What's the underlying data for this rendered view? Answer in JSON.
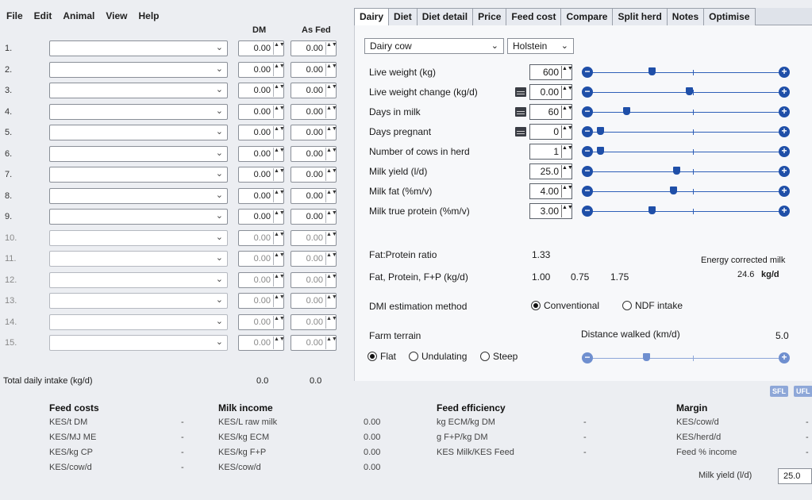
{
  "menu": [
    "File",
    "Edit",
    "Animal",
    "View",
    "Help"
  ],
  "feed_table": {
    "col_dm": "DM",
    "col_asfed": "As Fed",
    "rows": [
      {
        "num": "1.",
        "dm": "0.00",
        "asfed": "0.00"
      },
      {
        "num": "2.",
        "dm": "0.00",
        "asfed": "0.00"
      },
      {
        "num": "3.",
        "dm": "0.00",
        "asfed": "0.00"
      },
      {
        "num": "4.",
        "dm": "0.00",
        "asfed": "0.00"
      },
      {
        "num": "5.",
        "dm": "0.00",
        "asfed": "0.00"
      },
      {
        "num": "6.",
        "dm": "0.00",
        "asfed": "0.00"
      },
      {
        "num": "7.",
        "dm": "0.00",
        "asfed": "0.00"
      },
      {
        "num": "8.",
        "dm": "0.00",
        "asfed": "0.00"
      },
      {
        "num": "9.",
        "dm": "0.00",
        "asfed": "0.00"
      },
      {
        "num": "10.",
        "dm": "0.00",
        "asfed": "0.00"
      },
      {
        "num": "11.",
        "dm": "0.00",
        "asfed": "0.00"
      },
      {
        "num": "12.",
        "dm": "0.00",
        "asfed": "0.00"
      },
      {
        "num": "13.",
        "dm": "0.00",
        "asfed": "0.00"
      },
      {
        "num": "14.",
        "dm": "0.00",
        "asfed": "0.00"
      },
      {
        "num": "15.",
        "dm": "0.00",
        "asfed": "0.00"
      }
    ],
    "total_label": "Total daily intake (kg/d)",
    "total_dm": "0.0",
    "total_asfed": "0.0"
  },
  "tabs": [
    "Dairy",
    "Diet",
    "Diet detail",
    "Price",
    "Feed cost",
    "Compare",
    "Split herd",
    "Notes",
    "Optimise"
  ],
  "active_tab": "Dairy",
  "dairy": {
    "animal_type": "Dairy cow",
    "breed": "Holstein",
    "params": [
      {
        "label": "Live weight (kg)",
        "value": "600",
        "slider_level": 0.31,
        "calc": false
      },
      {
        "label": "Live weight change (kg/d)",
        "value": "0.00",
        "slider_level": 0.52,
        "calc": true
      },
      {
        "label": "Days in milk",
        "value": "60",
        "slider_level": 0.17,
        "calc": true
      },
      {
        "label": "Days pregnant",
        "value": "0",
        "slider_level": 0.02,
        "calc": true
      },
      {
        "label": "Number of cows in herd",
        "value": "1",
        "slider_level": 0.02,
        "calc": false
      },
      {
        "label": "Milk yield (l/d)",
        "value": "25.0",
        "slider_level": 0.45,
        "calc": false
      },
      {
        "label": "Milk fat (%m/v)",
        "value": "4.00",
        "slider_level": 0.43,
        "calc": false
      },
      {
        "label": "Milk true protein (%m/v)",
        "value": "3.00",
        "slider_level": 0.31,
        "calc": false
      }
    ],
    "fat_protein_ratio_label": "Fat:Protein ratio",
    "fat_protein_ratio": "1.33",
    "fp_label": "Fat, Protein, F+P (kg/d)",
    "fp_fat": "1.00",
    "fp_protein": "0.75",
    "fp_total": "1.75",
    "ecm_label": "Energy corrected milk",
    "ecm_value": "24.6",
    "ecm_unit": "kg/d",
    "dmi_label": "DMI estimation method",
    "dmi_options": [
      "Conventional",
      "NDF intake"
    ],
    "dmi_selected": "Conventional",
    "terrain_label": "Farm terrain",
    "terrain_options": [
      "Flat",
      "Undulating",
      "Steep"
    ],
    "terrain_selected": "Flat",
    "distance_label": "Distance walked (km/d)",
    "distance_value": "5.0",
    "distance_slider_level": 0.28
  },
  "badges": [
    "SFL",
    "UFL"
  ],
  "summary": {
    "feed_costs": {
      "title": "Feed costs",
      "items": [
        {
          "label": "KES/t DM",
          "value": "-"
        },
        {
          "label": "KES/MJ ME",
          "value": "-"
        },
        {
          "label": "KES/kg CP",
          "value": "-"
        },
        {
          "label": "KES/cow/d",
          "value": "-"
        }
      ]
    },
    "milk_income": {
      "title": "Milk income",
      "items": [
        {
          "label": "KES/L raw milk",
          "value": "0.00"
        },
        {
          "label": "KES/kg ECM",
          "value": "0.00"
        },
        {
          "label": "KES/kg F+P",
          "value": "0.00"
        },
        {
          "label": "KES/cow/d",
          "value": "0.00"
        }
      ]
    },
    "feed_efficiency": {
      "title": "Feed efficiency",
      "items": [
        {
          "label": "kg ECM/kg DM",
          "value": "-"
        },
        {
          "label": "g F+P/kg DM",
          "value": "-"
        },
        {
          "label": "KES Milk/KES Feed",
          "value": "-"
        }
      ]
    },
    "margin": {
      "title": "Margin",
      "items": [
        {
          "label": "KES/cow/d",
          "value": "-"
        },
        {
          "label": "KES/herd/d",
          "value": "-"
        },
        {
          "label": "Feed % income",
          "value": "-"
        }
      ]
    },
    "milk_yield_label": "Milk yield (l/d)",
    "milk_yield_value": "25.0"
  }
}
